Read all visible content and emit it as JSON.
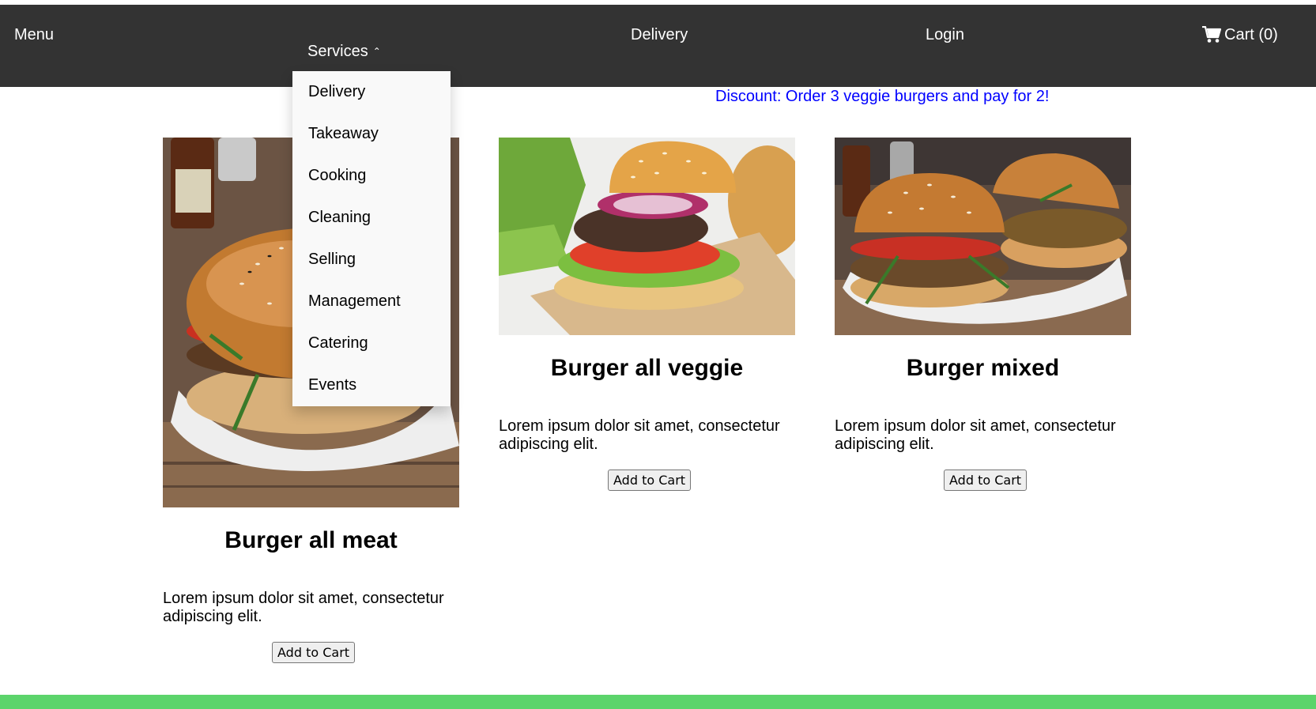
{
  "nav": {
    "menu_label": "Menu",
    "services_label": "Services",
    "delivery_label": "Delivery",
    "login_label": "Login",
    "cart_label": "Cart (0)",
    "icons": {
      "cart": "shopping-cart-icon",
      "caret": "caret-up-icon"
    }
  },
  "dropdown": {
    "items": [
      "Delivery",
      "Takeaway",
      "Cooking",
      "Cleaning",
      "Selling",
      "Management",
      "Catering",
      "Events"
    ]
  },
  "discount": {
    "text": "Discount: Order 3 veggie burgers and pay for 2!"
  },
  "products": [
    {
      "title": "Burger all meat",
      "description": "Lorem ipsum dolor sit amet, consectetur adipiscing elit.",
      "button": "Add to Cart"
    },
    {
      "title": "Burger all veggie",
      "description": "Lorem ipsum dolor sit amet, consectetur adipiscing elit.",
      "button": "Add to Cart"
    },
    {
      "title": "Burger mixed",
      "description": "Lorem ipsum dolor sit amet, consectetur adipiscing elit.",
      "button": "Add to Cart"
    }
  ],
  "colors": {
    "navbar": "#333333",
    "discount": "#0000ff",
    "footer": "#5cd46b",
    "dropdown_bg": "#f9f9f9"
  }
}
